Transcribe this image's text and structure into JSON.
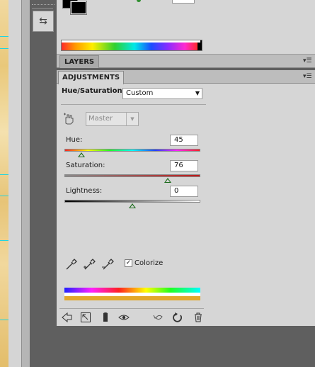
{
  "panels": {
    "layers": {
      "tab": "LAYERS"
    },
    "adjustments": {
      "tab": "ADJUSTMENTS"
    }
  },
  "adjustment": {
    "title": "Hue/Saturation",
    "preset": "Custom",
    "channel": "Master",
    "hue": {
      "label": "Hue:",
      "value": "45",
      "fraction": 0.125
    },
    "saturation": {
      "label": "Saturation:",
      "value": "76",
      "fraction": 0.76
    },
    "lightness": {
      "label": "Lightness:",
      "value": "0",
      "fraction": 0.5
    },
    "colorize": {
      "label": "Colorize",
      "checked": true
    }
  },
  "icons": {
    "swap": "swap-arrows-icon",
    "panel_menu": "panel-menu-icon",
    "hand": "target-adjust-hand-icon",
    "eyedroppers": [
      "eyedropper-icon",
      "eyedropper-add-icon",
      "eyedropper-subtract-icon"
    ],
    "footer": [
      "return-arrow-icon",
      "expand-view-icon",
      "clip-to-layer-icon",
      "visibility-eye-icon",
      "view-previous-icon",
      "reset-icon",
      "trash-icon"
    ]
  },
  "colors": {
    "panel_bg": "#d6d6d6",
    "header_bg": "#bdbdbd",
    "workspace_bg": "#5f5f5f",
    "guide": "#20d4e0",
    "thumb": "#1b6b1b",
    "colorized_ramp": "#e3a82a"
  }
}
